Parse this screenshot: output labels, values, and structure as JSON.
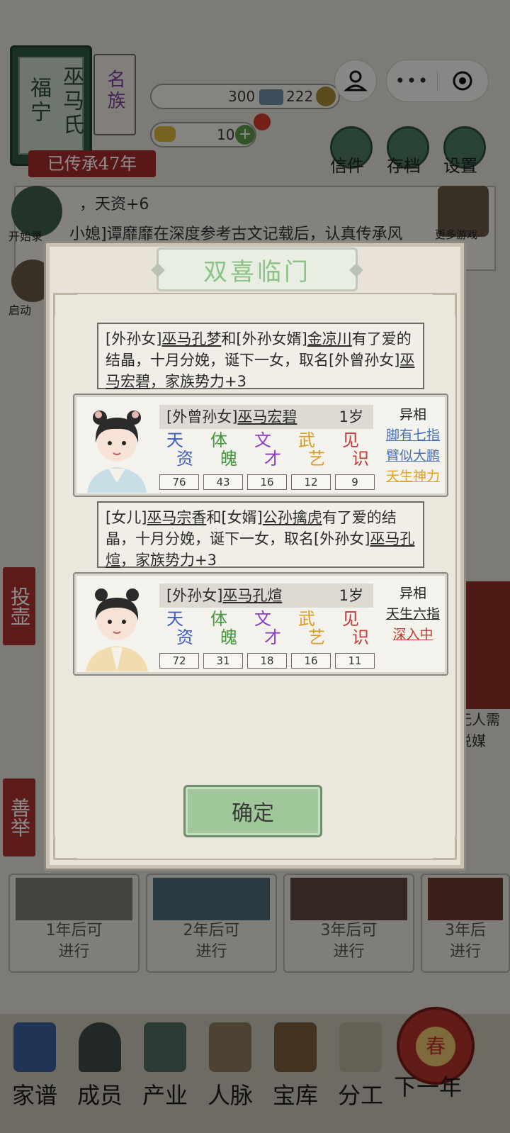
{
  "family": {
    "name_left": "福宁",
    "name_right": "巫马氏",
    "badge": "名族",
    "heritage": "已传承47年"
  },
  "resources": {
    "silver": "300",
    "copper": "222",
    "gold": "10"
  },
  "top_menu": {
    "letters": "信件",
    "save": "存档",
    "settings": "设置"
  },
  "side_actions": {
    "record": "开始录",
    "launch": "启动",
    "more_games": "更多游戏"
  },
  "log": {
    "line1": "，天资+6",
    "line2": "小媳]谭靡靡在深度参考古文记载后，认真传承风"
  },
  "side_tags": {
    "tag1": "投壶",
    "tag2": "善举"
  },
  "right_snippets": {
    "line1": "无人需",
    "line2": "说媒"
  },
  "bottom_cards": [
    {
      "label": "1年后可\n进行"
    },
    {
      "label": "2年后可\n进行"
    },
    {
      "label": "3年后可\n进行"
    },
    {
      "label": "3年后\n进行"
    }
  ],
  "nav": {
    "items": [
      "家谱",
      "成员",
      "产业",
      "人脉",
      "宝库",
      "分工"
    ],
    "next_year": "下一年",
    "spring": "春"
  },
  "modal": {
    "title": "双喜临门",
    "confirm": "确定",
    "messages": [
      {
        "parts": [
          "[外孙女]",
          "巫马孔梦",
          "和[外孙女婿]",
          "金凉川",
          "有了爱的结晶，十月分娩，诞下一女，取名[外曾孙女]",
          "巫马宏碧",
          "，家族势力+3"
        ]
      },
      {
        "parts": [
          "[女儿]",
          "巫马宗香",
          "和[女婿]",
          "公孙擒虎",
          "有了爱的结晶，十月分娩，诞下一女，取名[外孙女]",
          "巫马孔煊",
          "，家族势力+3"
        ]
      }
    ],
    "stat_labels": [
      {
        "c1": "天",
        "c2": "资",
        "color": "#3c5fc0"
      },
      {
        "c1": "体",
        "c2": "魄",
        "color": "#3f9a3a"
      },
      {
        "c1": "文",
        "c2": "才",
        "color": "#8a3fc0"
      },
      {
        "c1": "武",
        "c2": "艺",
        "color": "#d89a1f"
      },
      {
        "c1": "见",
        "c2": "识",
        "color": "#c23a3a"
      }
    ],
    "children": [
      {
        "relation": "[外曾孙女]",
        "name": "巫马宏碧",
        "age": "1岁",
        "stats": [
          "76",
          "43",
          "16",
          "12",
          "9"
        ],
        "traits_head": "异相",
        "traits": [
          "脚有七指",
          "臂似大鹏",
          "天生神力"
        ]
      },
      {
        "relation": "[外孙女]",
        "name": "巫马孔煊",
        "age": "1岁",
        "stats": [
          "72",
          "31",
          "18",
          "16",
          "11"
        ],
        "traits_head": "异相",
        "traits": [
          "天生六指",
          "深入中"
        ]
      }
    ]
  }
}
